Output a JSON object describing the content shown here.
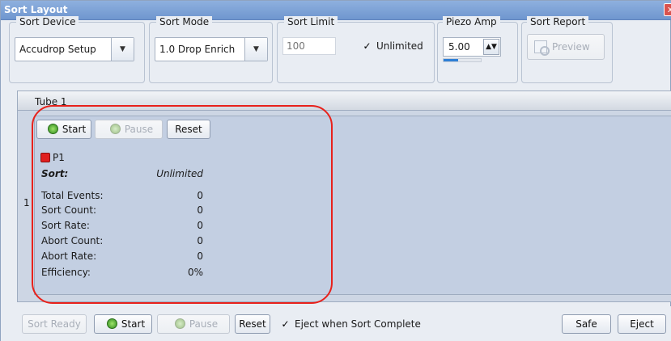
{
  "window": {
    "title": "Sort Layout",
    "close_icon": "close-icon",
    "close_symbol": "x"
  },
  "toolbar": {
    "sort_device": {
      "label": "Sort Device",
      "value": "Accudrop Setup"
    },
    "sort_mode": {
      "label": "Sort Mode",
      "value": "1.0 Drop Enrich"
    },
    "sort_limit": {
      "label": "Sort Limit",
      "placeholder": "100",
      "unlimited_label": "Unlimited",
      "unlimited_checked": true
    },
    "piezo_amp": {
      "label": "Piezo Amp",
      "value": "5.00",
      "level_fraction": 0.4
    },
    "sort_report": {
      "label": "Sort Report",
      "preview_label": "Preview"
    }
  },
  "tube": {
    "title": "Tube 1",
    "row_index": "1",
    "start_label": "Start",
    "pause_label": "Pause",
    "reset_label": "Reset",
    "population": {
      "name": "P1",
      "color": "#e02020"
    },
    "sort": {
      "label": "Sort:",
      "value": "Unlimited"
    },
    "stats": [
      {
        "label": "Total Events:",
        "value": "0"
      },
      {
        "label": "Sort Count:",
        "value": "0"
      },
      {
        "label": "Sort Rate:",
        "value": "0"
      },
      {
        "label": "Abort Count:",
        "value": "0"
      },
      {
        "label": "Abort Rate:",
        "value": "0"
      },
      {
        "label": "Efficiency:",
        "value": "0%"
      }
    ]
  },
  "bottom": {
    "sort_ready_label": "Sort Ready",
    "start_label": "Start",
    "pause_label": "Pause",
    "reset_label": "Reset",
    "eject_complete_label": "Eject when Sort Complete",
    "eject_complete_checked": true,
    "safe_label": "Safe",
    "eject_label": "Eject"
  },
  "colors": {
    "title_bar": "#7a9fd6",
    "panel": "#c3cfe2",
    "highlight": "#e8211b",
    "led_on": "#3fae25"
  },
  "glyphs": {
    "check": "✓",
    "dropdown": "▼",
    "spin": "▲▼"
  }
}
